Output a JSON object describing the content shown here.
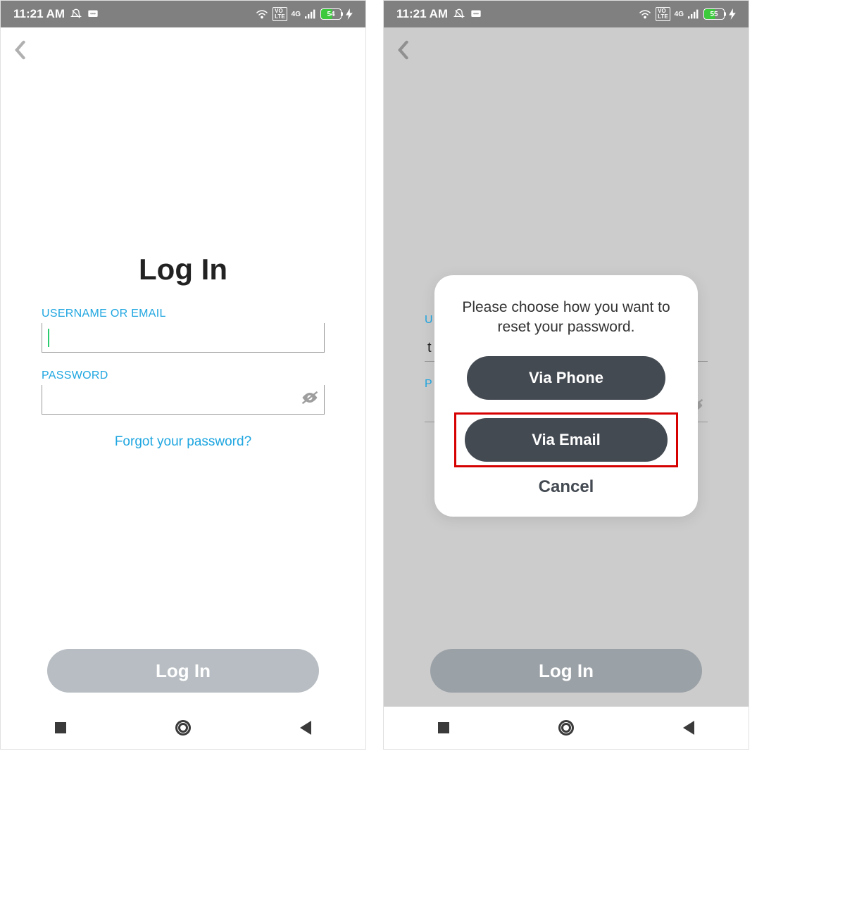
{
  "statusBar": {
    "time": "11:21 AM",
    "network": "4G",
    "volte": "VO\nLTE",
    "batteryLeft": "54",
    "batteryRight": "55"
  },
  "screen1": {
    "title": "Log In",
    "usernameLabel": "USERNAME OR EMAIL",
    "passwordLabel": "PASSWORD",
    "forgotText": "Forgot your password?",
    "loginBtn": "Log In"
  },
  "screen2": {
    "usernameLabelPeek": "U",
    "passwordLabelPeek": "P",
    "usernameValue": "t",
    "loginBtn": "Log In",
    "modal": {
      "message": "Please choose how you want to reset your password.",
      "viaPhone": "Via Phone",
      "viaEmail": "Via Email",
      "cancel": "Cancel"
    }
  }
}
